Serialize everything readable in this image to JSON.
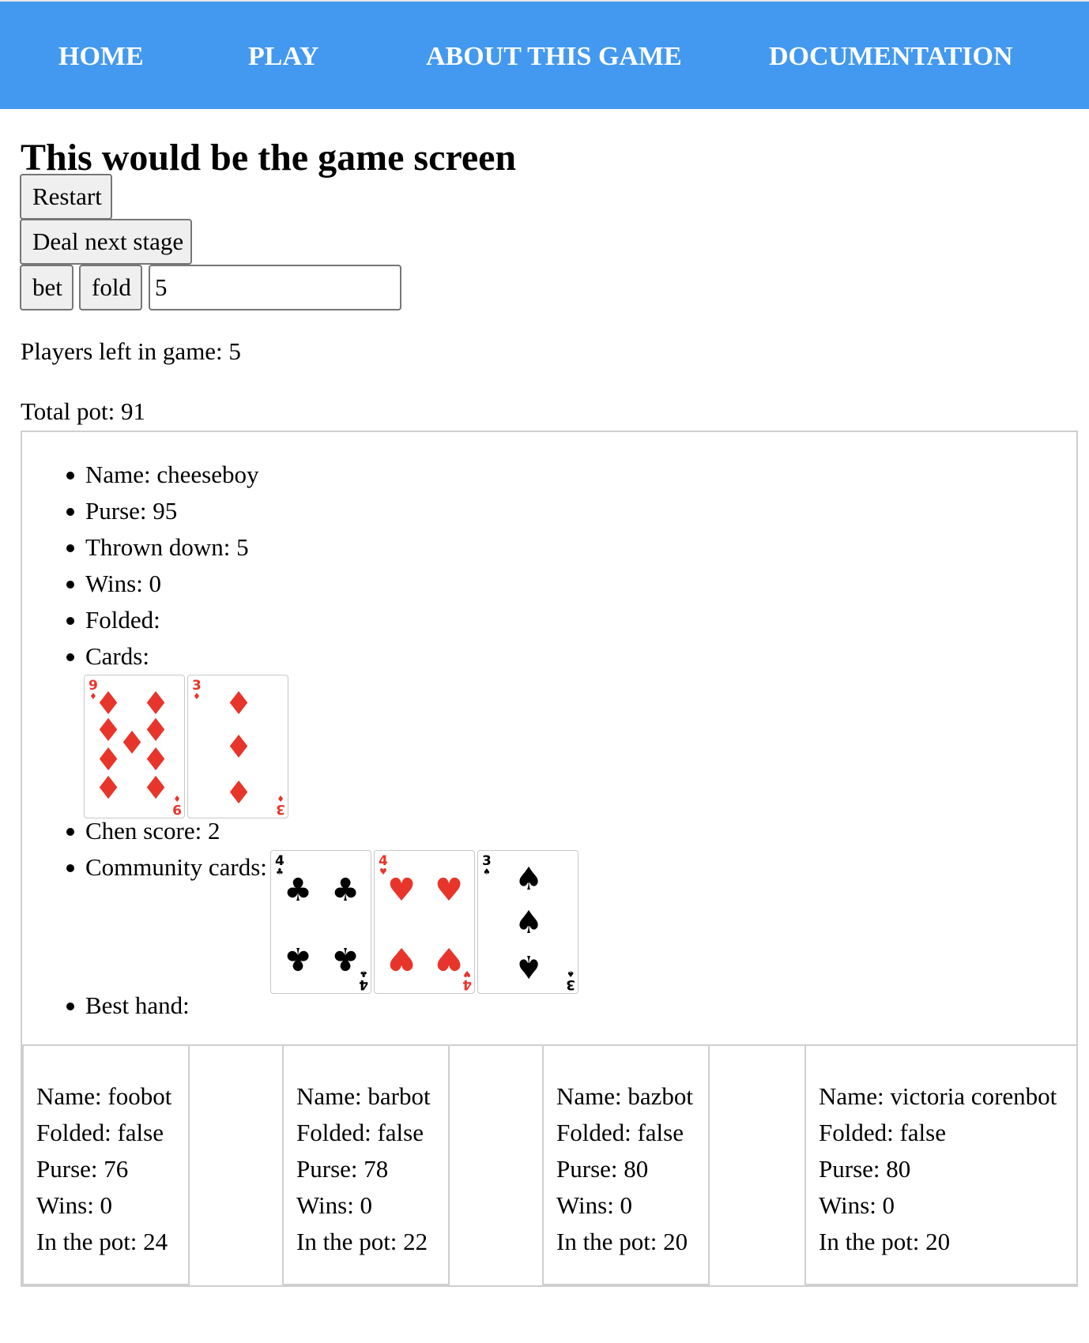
{
  "nav": {
    "items": [
      "HOME",
      "PLAY",
      "ABOUT THIS GAME",
      "DOCUMENTATION"
    ],
    "background": "#4399f0"
  },
  "page_title": "This would be the game screen",
  "controls": {
    "restart_label": "Restart",
    "deal_label": "Deal next stage",
    "bet_label": "bet",
    "fold_label": "fold",
    "bet_amount": "5"
  },
  "status": {
    "players_left": "Players left in game: 5",
    "total_pot": "Total pot: 91"
  },
  "player": {
    "name": "Name: cheeseboy",
    "purse": "Purse: 95",
    "thrown_down": "Thrown down: 5",
    "wins": "Wins: 0",
    "folded": "Folded:",
    "cards_label": "Cards:",
    "chen_score": "Chen score: 2",
    "community_label": "Community cards:",
    "best_hand": "Best hand:",
    "hand": [
      {
        "rank": "9",
        "suit": "diamonds",
        "color": "#e8352b"
      },
      {
        "rank": "3",
        "suit": "diamonds",
        "color": "#e8352b"
      }
    ],
    "community": [
      {
        "rank": "4",
        "suit": "clubs",
        "color": "#000000"
      },
      {
        "rank": "4",
        "suit": "hearts",
        "color": "#e8352b"
      },
      {
        "rank": "3",
        "suit": "spades",
        "color": "#000000"
      }
    ]
  },
  "opponents": [
    {
      "name": "Name: foobot",
      "folded": "Folded: false",
      "purse": "Purse: 76",
      "wins": "Wins: 0",
      "pot": "In the pot: 24"
    },
    {
      "name": "Name: barbot",
      "folded": "Folded: false",
      "purse": "Purse: 78",
      "wins": "Wins: 0",
      "pot": "In the pot: 22"
    },
    {
      "name": "Name: bazbot",
      "folded": "Folded: false",
      "purse": "Purse: 80",
      "wins": "Wins: 0",
      "pot": "In the pot: 20"
    },
    {
      "name": "Name: victoria corenbot",
      "folded": "Folded: false",
      "purse": "Purse: 80",
      "wins": "Wins: 0",
      "pot": "In the pot: 20"
    }
  ]
}
